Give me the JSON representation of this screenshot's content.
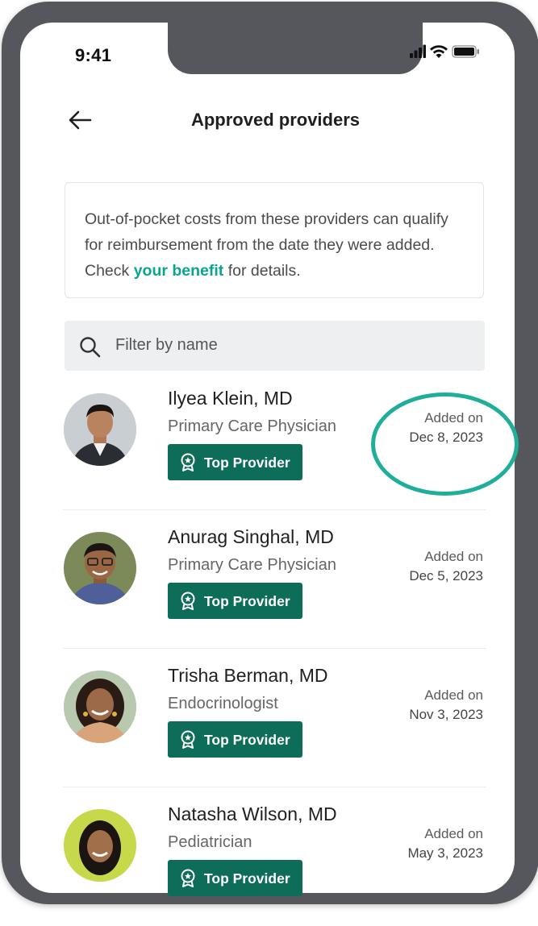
{
  "status_bar": {
    "time": "9:41",
    "icons": [
      "signal-icon",
      "wifi-icon",
      "battery-icon"
    ]
  },
  "header": {
    "back_icon": "arrow-left-icon",
    "title": "Approved providers"
  },
  "info": {
    "text_before": "Out-of-pocket costs from these providers can qualify for reimbursement from the date they were added. Check ",
    "link_text": "your benefit",
    "text_after": " for details."
  },
  "search": {
    "icon": "search-icon",
    "placeholder": "Filter by name"
  },
  "providers": [
    {
      "name": "Ilyea Klein, MD",
      "specialty": "Primary Care Physician",
      "badge": "Top Provider",
      "added_label": "Added on",
      "added_date": "Dec 8, 2023"
    },
    {
      "name": "Anurag Singhal, MD",
      "specialty": "Primary Care Physician",
      "badge": "Top Provider",
      "added_label": "Added on",
      "added_date": "Dec 5, 2023"
    },
    {
      "name": "Trisha Berman, MD",
      "specialty": "Endocrinologist",
      "badge": "Top Provider",
      "added_label": "Added on",
      "added_date": "Nov 3, 2023"
    },
    {
      "name": "Natasha Wilson, MD",
      "specialty": "Pediatrician",
      "badge": "Top Provider",
      "added_label": "Added on",
      "added_date": "May 3, 2023"
    }
  ],
  "colors": {
    "accent_link": "#0aa58c",
    "badge_bg": "#0e6d58",
    "highlight_ring": "#1fae9a",
    "phone_frame": "#55575c"
  }
}
